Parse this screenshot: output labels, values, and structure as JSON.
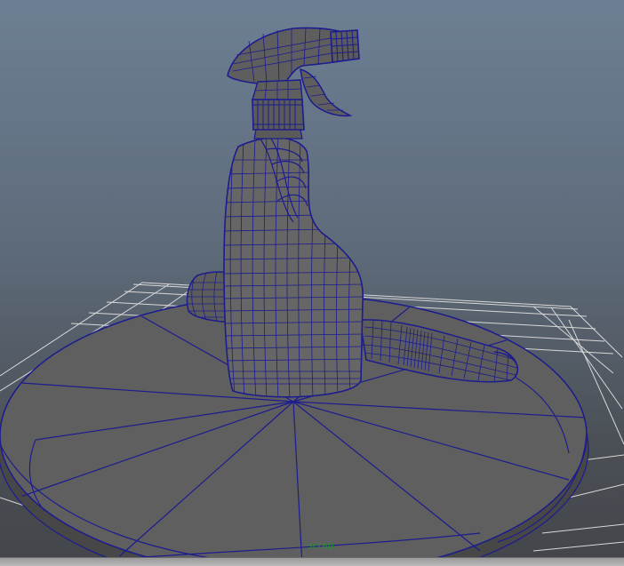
{
  "viewport": {
    "object_label": "scrap",
    "colors": {
      "background_top": "#6d7f94",
      "background_bottom": "#43454a",
      "grid": "#d8d8d8",
      "wireframe": "#1c1c8e",
      "surface": "#5f5f5f",
      "label": "#1a9a2a"
    }
  }
}
